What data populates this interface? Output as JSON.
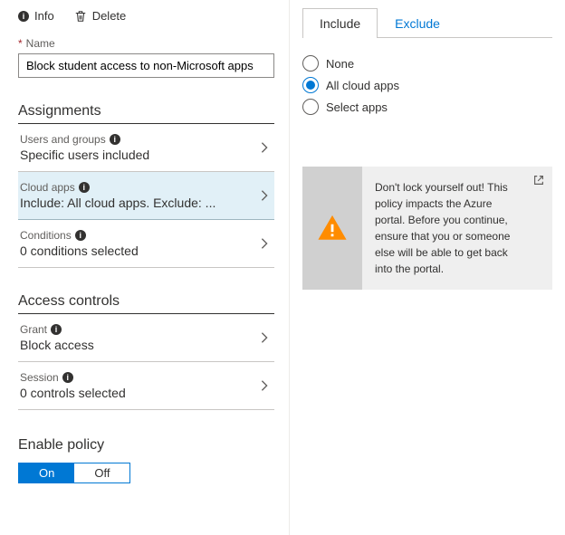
{
  "toolbar": {
    "info": "Info",
    "delete": "Delete"
  },
  "nameField": {
    "label": "Name",
    "value": "Block student access to non-Microsoft apps"
  },
  "sections": {
    "assignments": {
      "title": "Assignments",
      "rows": [
        {
          "label": "Users and groups",
          "value": "Specific users included"
        },
        {
          "label": "Cloud apps",
          "value": "Include: All cloud apps. Exclude: ..."
        },
        {
          "label": "Conditions",
          "value": "0 conditions selected"
        }
      ]
    },
    "access": {
      "title": "Access controls",
      "rows": [
        {
          "label": "Grant",
          "value": "Block access"
        },
        {
          "label": "Session",
          "value": "0 controls selected"
        }
      ]
    }
  },
  "enable": {
    "title": "Enable policy",
    "on": "On",
    "off": "Off"
  },
  "tabs": {
    "include": "Include",
    "exclude": "Exclude"
  },
  "options": {
    "none": "None",
    "all": "All cloud apps",
    "select": "Select apps"
  },
  "warning": "Don't lock yourself out! This policy impacts the Azure portal. Before you continue, ensure that you or someone else will be able to get back into the portal."
}
